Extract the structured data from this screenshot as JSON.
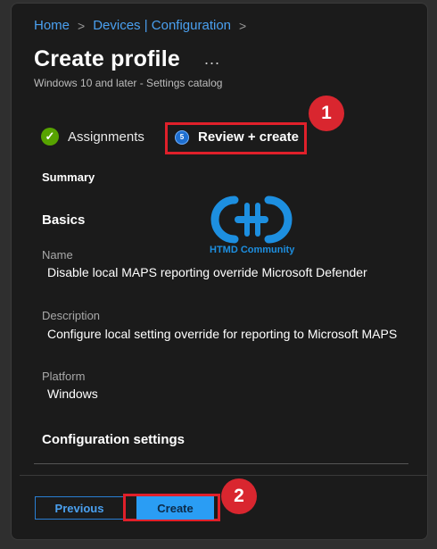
{
  "breadcrumb": [
    "Home",
    "Devices | Configuration"
  ],
  "page": {
    "title": "Create profile",
    "more": "...",
    "subtitle": "Windows 10 and later - Settings catalog"
  },
  "steps": {
    "assignments": "Assignments",
    "review_num": "5",
    "review": "Review + create"
  },
  "callouts": {
    "one": "1",
    "two": "2"
  },
  "summary": {
    "heading": "Summary",
    "basics": "Basics",
    "name_label": "Name",
    "name_value": "Disable local MAPS reporting override  Microsoft Defender",
    "description_label": "Description",
    "description_value": "Configure local setting override for reporting to Microsoft MAPS",
    "platform_label": "Platform",
    "platform_value": "Windows",
    "configuration": "Configuration settings"
  },
  "watermark": {
    "text": "HTMD Community"
  },
  "footer": {
    "previous": "Previous",
    "create": "Create"
  },
  "colors": {
    "accent": "#2a9df4",
    "highlight": "#e0202a",
    "success": "#57a300"
  }
}
